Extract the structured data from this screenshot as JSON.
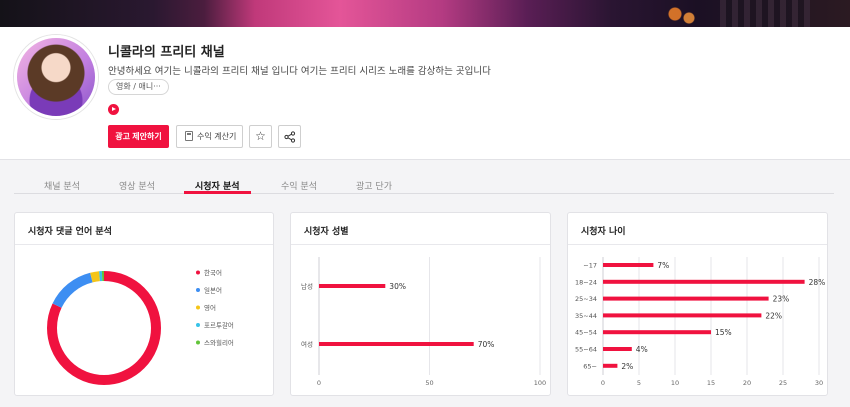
{
  "channel": {
    "title": "니콜라의 프리티 채널",
    "description": "안녕하세요 여기는 니콜라의 프리티 채널 입니다 여기는 프리티 시리즈 노래를 감상하는 곳입니다",
    "category": "영화 / 애니···",
    "platform_icon": "youtube-icon"
  },
  "actions": {
    "propose_label": "광고 제안하기",
    "calc_label": "수익 계산기",
    "favorite_icon": "star-icon",
    "share_icon": "share-icon"
  },
  "tabs": [
    {
      "label": "채널 분석"
    },
    {
      "label": "영상 분석"
    },
    {
      "label": "시청자 분석",
      "active": true
    },
    {
      "label": "수익 분석"
    },
    {
      "label": "광고 단가"
    }
  ],
  "cards": {
    "language": {
      "title": "시청자 댓글 언어 분석"
    },
    "gender": {
      "title": "시청자 성별"
    },
    "age": {
      "title": "시청자 나이"
    }
  },
  "colors": {
    "accent": "#f0123f"
  },
  "chart_data": [
    {
      "type": "pie",
      "donut": true,
      "legend_position": "right",
      "categories": [
        "한국어",
        "일본어",
        "영어",
        "포르투갈어",
        "스와힐리어"
      ],
      "values": [
        82,
        14,
        2.5,
        0.8,
        0.7
      ],
      "colors": [
        "#f0123f",
        "#3d8ef2",
        "#f5c518",
        "#38c3e8",
        "#62c43a"
      ]
    },
    {
      "type": "bar",
      "orientation": "horizontal",
      "categories": [
        "남성",
        "여성"
      ],
      "values": [
        30,
        70
      ],
      "value_labels": [
        "30%",
        "70%"
      ],
      "xlim": [
        0,
        100
      ],
      "xticks": [
        "0",
        "50",
        "100"
      ],
      "grid": true
    },
    {
      "type": "bar",
      "orientation": "horizontal",
      "categories": [
        "~17",
        "18~24",
        "25~34",
        "35~44",
        "45~54",
        "55~64",
        "65~"
      ],
      "values": [
        7,
        28,
        23,
        22,
        15,
        4,
        2
      ],
      "value_labels": [
        "7%",
        "28%",
        "23%",
        "22%",
        "15%",
        "4%",
        "2%"
      ],
      "xlim": [
        0,
        30
      ],
      "xticks": [
        "0",
        "5",
        "10",
        "15",
        "20",
        "25",
        "30"
      ],
      "grid": true
    }
  ]
}
